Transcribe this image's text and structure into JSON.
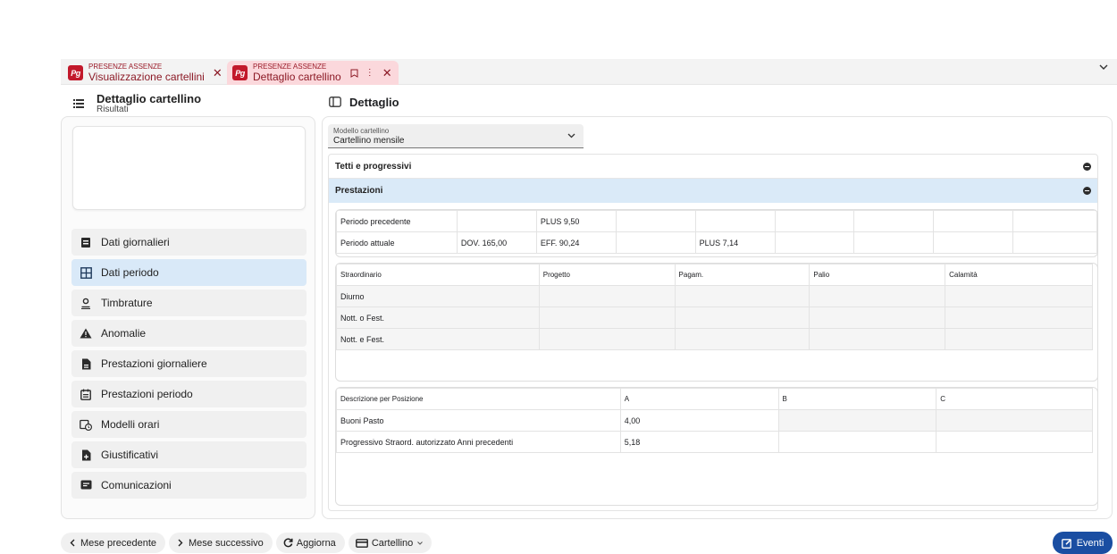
{
  "tabs": [
    {
      "small": "PRESENZE ASSENZE",
      "label": "Visualizzazione cartellini",
      "logo": "Pg"
    },
    {
      "small": "PRESENZE ASSENZE",
      "label": "Dettaglio cartellino",
      "logo": "Pg"
    }
  ],
  "left_header": {
    "title": "Dettaglio cartellino",
    "subtitle": "Risultati"
  },
  "nav": [
    {
      "label": "Dati giornalieri",
      "icon": "calendar-day-icon"
    },
    {
      "label": "Dati periodo",
      "icon": "grid-icon",
      "active": true
    },
    {
      "label": "Timbrature",
      "icon": "person-badge-icon"
    },
    {
      "label": "Anomalie",
      "icon": "warning-icon"
    },
    {
      "label": "Prestazioni giornaliere",
      "icon": "document-icon"
    },
    {
      "label": "Prestazioni periodo",
      "icon": "calendar-list-icon"
    },
    {
      "label": "Modelli orari",
      "icon": "calendar-clock-icon"
    },
    {
      "label": "Giustificativi",
      "icon": "document-plus-icon"
    },
    {
      "label": "Comunicazioni",
      "icon": "message-icon"
    }
  ],
  "right_header": {
    "title": "Dettaglio"
  },
  "model_select": {
    "label": "Modello cartellino",
    "value": "Cartellino mensile"
  },
  "accordions": [
    {
      "label": "Tetti e progressivi"
    },
    {
      "label": "Prestazioni"
    }
  ],
  "period_table": {
    "rows": [
      [
        "Periodo precedente",
        "",
        "PLUS 9,50",
        "",
        "",
        "",
        "",
        "",
        ""
      ],
      [
        "Periodo attuale",
        "DOV. 165,00",
        "EFF. 90,24",
        "",
        "PLUS 7,14",
        "",
        "",
        "",
        ""
      ]
    ]
  },
  "overtime_table": {
    "headers": [
      "Straordinario",
      "Progetto",
      "Pagam.",
      "Palio",
      "Calamità"
    ],
    "rows": [
      [
        "Diurno",
        "",
        "",
        "",
        ""
      ],
      [
        "Nott. o Fest.",
        "",
        "",
        "",
        ""
      ],
      [
        "Nott. e Fest.",
        "",
        "",
        "",
        ""
      ]
    ]
  },
  "position_table": {
    "headers": [
      "Descrizione per Posizione",
      "A",
      "B",
      "C"
    ],
    "rows": [
      [
        "Buoni Pasto",
        "4,00",
        "",
        ""
      ],
      [
        "Progressivo Straord. autorizzato Anni precedenti",
        "5,18",
        "",
        ""
      ]
    ]
  },
  "bottom": {
    "prev": "Mese precedente",
    "next": "Mese successivo",
    "refresh": "Aggiorna",
    "card": "Cartellino",
    "events": "Eventi"
  },
  "colors": {
    "brand": "#c2192b",
    "active_tab": "#fbd8dc",
    "accent": "#1a4ea2",
    "selected": "#d9e9f8"
  }
}
